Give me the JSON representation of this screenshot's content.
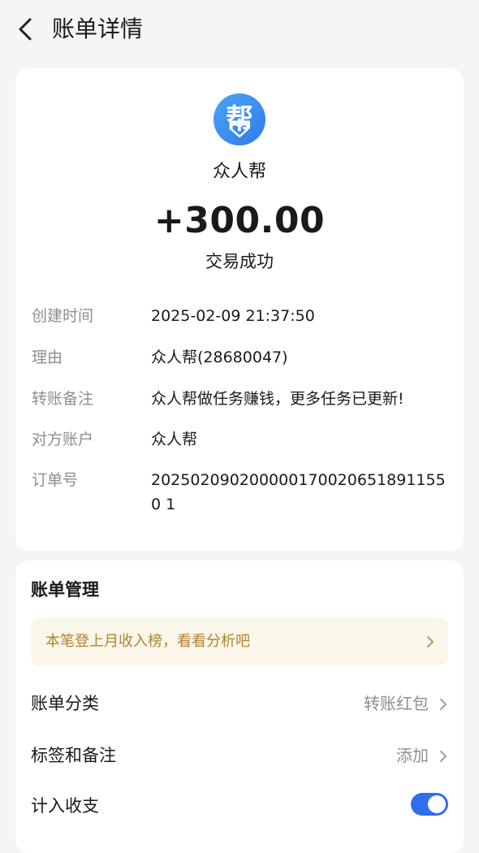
{
  "header": {
    "title": "账单详情"
  },
  "transaction": {
    "merchant": "众人帮",
    "logo_char": "帮",
    "amount": "+300.00",
    "status": "交易成功",
    "details": {
      "created_label": "创建时间",
      "created_value": "2025-02-09 21:37:50",
      "reason_label": "理由",
      "reason_value": "众人帮(28680047)",
      "remark_label": "转账备注",
      "remark_value": "众人帮做任务赚钱，更多任务已更新!",
      "counterparty_label": "对方账户",
      "counterparty_value": "众人帮",
      "order_label": "订单号",
      "order_value": "2025020902000001700206518911550 1"
    }
  },
  "manage": {
    "title": "账单管理",
    "banner_text": "本笔登上月收入榜，看看分析吧",
    "category_label": "账单分类",
    "category_value": "转账红包",
    "tag_label": "标签和备注",
    "tag_value": "添加",
    "count_label": "计入收支",
    "count_enabled": true
  },
  "colors": {
    "accent": "#2f6fed",
    "banner_bg": "#fbf6ea",
    "banner_text": "#b0842f",
    "logo_blue": "#3a8ff0"
  }
}
